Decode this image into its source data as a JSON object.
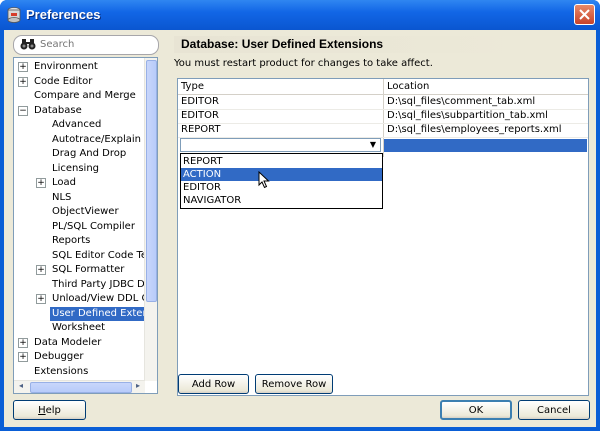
{
  "window": {
    "title": "Preferences"
  },
  "search": {
    "placeholder": "Search"
  },
  "tree": {
    "items": [
      {
        "label": "Environment",
        "expander": "+"
      },
      {
        "label": "Code Editor",
        "expander": "+"
      },
      {
        "label": "Compare and Merge",
        "expander": ""
      },
      {
        "label": "Database",
        "expander": "−"
      },
      {
        "label": "Advanced",
        "expander": ""
      },
      {
        "label": "Autotrace/Explain Plan",
        "expander": ""
      },
      {
        "label": "Drag And Drop",
        "expander": ""
      },
      {
        "label": "Licensing",
        "expander": ""
      },
      {
        "label": "Load",
        "expander": "+"
      },
      {
        "label": "NLS",
        "expander": ""
      },
      {
        "label": "ObjectViewer",
        "expander": ""
      },
      {
        "label": "PL/SQL Compiler",
        "expander": ""
      },
      {
        "label": "Reports",
        "expander": ""
      },
      {
        "label": "SQL Editor Code Templates",
        "expander": ""
      },
      {
        "label": "SQL Formatter",
        "expander": "+"
      },
      {
        "label": "Third Party JDBC Drivers",
        "expander": ""
      },
      {
        "label": "Unload/View DDL Options",
        "expander": "+"
      },
      {
        "label": "User Defined Extensions",
        "expander": "",
        "selected": true
      },
      {
        "label": "Worksheet",
        "expander": ""
      },
      {
        "label": "Data Modeler",
        "expander": "+"
      },
      {
        "label": "Debugger",
        "expander": "+"
      },
      {
        "label": "Extensions",
        "expander": ""
      }
    ]
  },
  "main": {
    "title": "Database: User Defined Extensions",
    "notice": "You must restart product for changes to take affect.",
    "columns": [
      "Type",
      "Location"
    ],
    "rows": [
      {
        "type": "EDITOR",
        "location": "D:\\sql_files\\comment_tab.xml"
      },
      {
        "type": "EDITOR",
        "location": "D:\\sql_files\\subpartition_tab.xml"
      },
      {
        "type": "REPORT",
        "location": "D:\\sql_files\\employees_reports.xml"
      }
    ],
    "combo_value": "",
    "dropdown_options": [
      "REPORT",
      "ACTION",
      "EDITOR",
      "NAVIGATOR"
    ],
    "highlighted_option": "ACTION"
  },
  "buttons": {
    "add_row": "Add Row",
    "remove_row": "Remove Row",
    "help_prefix": "",
    "help_mnemonic": "H",
    "help_rest": "elp",
    "ok": "OK",
    "cancel": "Cancel"
  },
  "colors": {
    "selection": "#316ac5",
    "titlebar": "#0a56d0"
  }
}
